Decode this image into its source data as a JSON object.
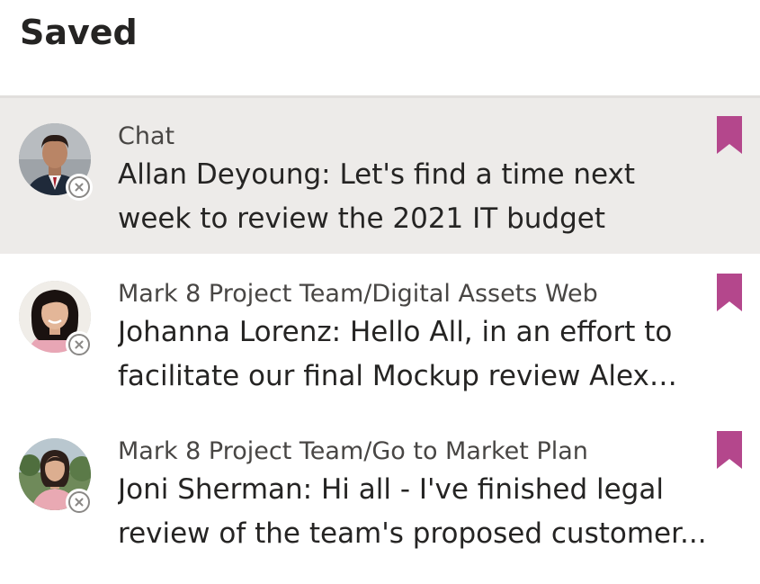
{
  "header": {
    "title": "Saved"
  },
  "colors": {
    "bookmark": "#b4478c",
    "selected_bg": "#edebe9"
  },
  "items": [
    {
      "context": "Chat",
      "message": "Allan Deyoung: Let's find a time next week to review the 2021 IT budget",
      "avatar": "person-avatar-man",
      "selected": true
    },
    {
      "context": "Mark 8 Project Team/Digital Assets Web",
      "message": "Johanna Lorenz: Hello All, in an effort to facilitate our final Mockup review Alex will...",
      "avatar": "person-avatar-woman",
      "selected": false
    },
    {
      "context": "Mark 8 Project Team/Go to Market Plan",
      "message": "Joni Sherman: Hi all - I've finished legal review of the team's proposed customer...",
      "avatar": "person-avatar-woman-outdoor",
      "selected": false
    }
  ]
}
